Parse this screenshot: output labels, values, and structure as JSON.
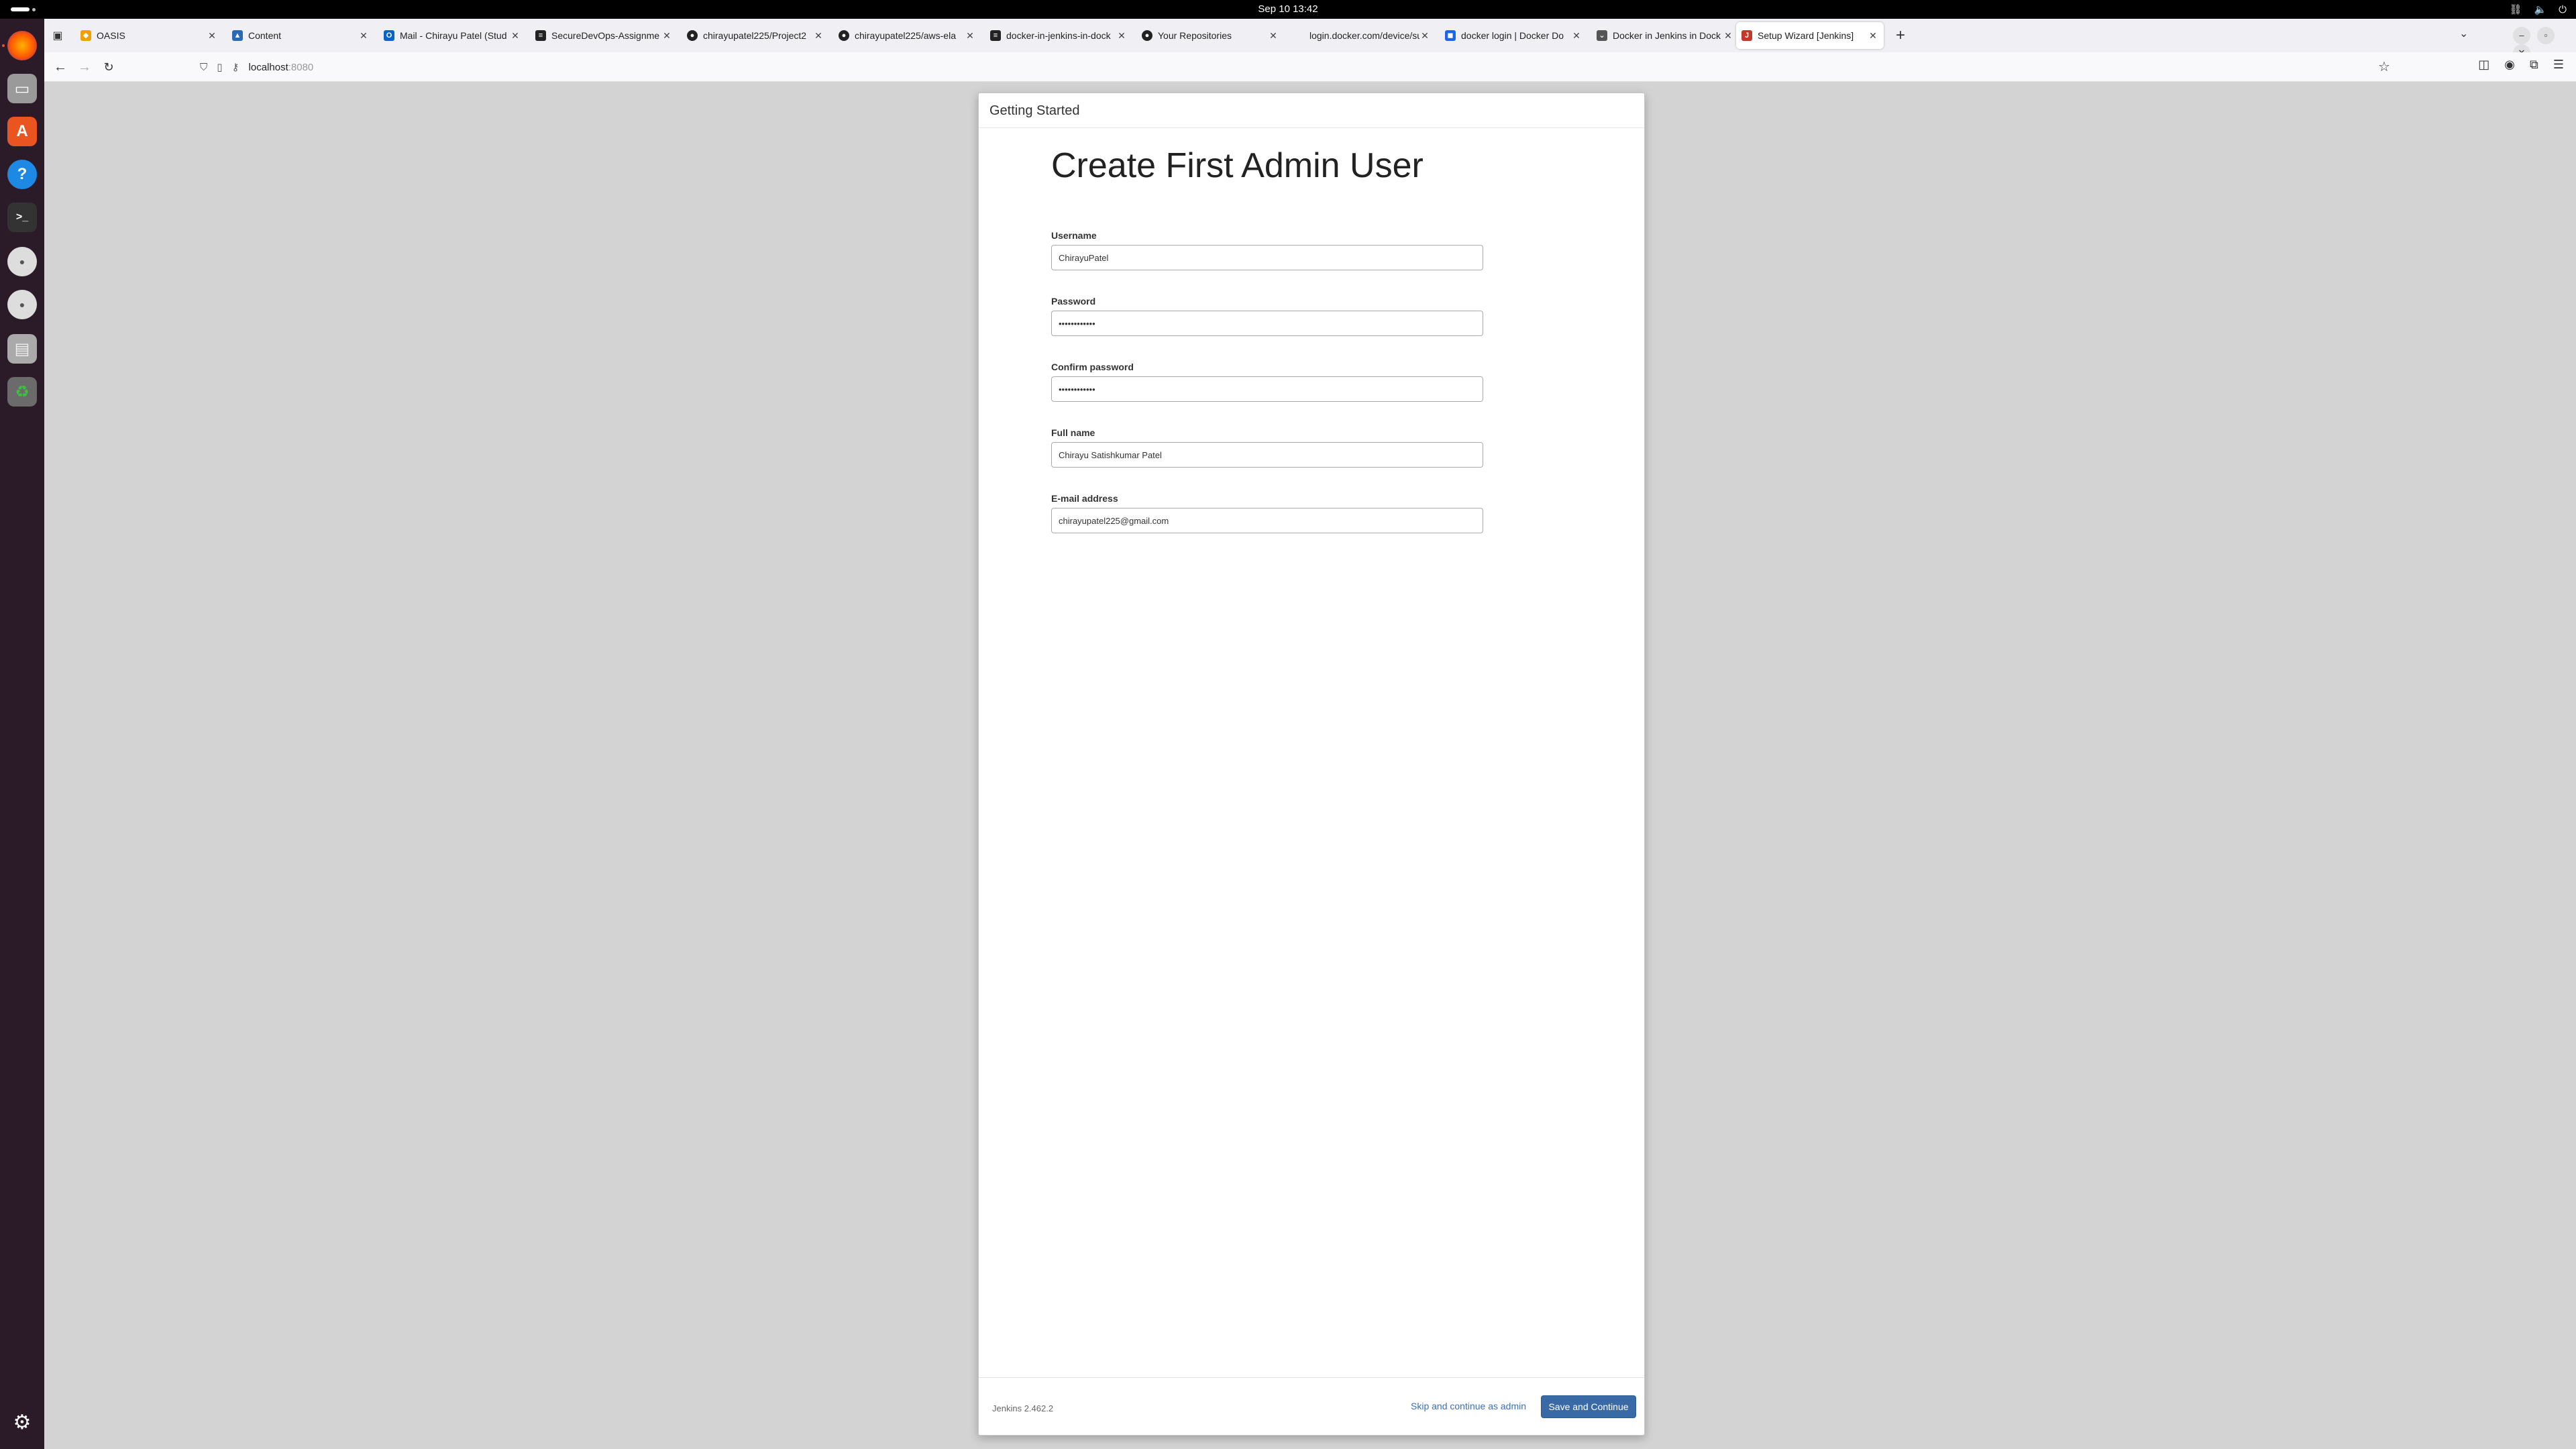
{
  "system": {
    "clock": "Sep 10  13:42"
  },
  "browser": {
    "tabs": [
      {
        "title": "OASIS",
        "icon": "oasis-icon",
        "color": "#f0a000"
      },
      {
        "title": "Content",
        "icon": "content-icon",
        "color": "#2a6ab5"
      },
      {
        "title": "Mail - Chirayu Patel (Stud",
        "icon": "outlook-icon",
        "color": "#0a64c8"
      },
      {
        "title": "SecureDevOps-Assignme",
        "icon": "docs-icon",
        "color": "#222222"
      },
      {
        "title": "chirayupatel225/Project2",
        "icon": "github-icon",
        "color": "#222222"
      },
      {
        "title": "chirayupatel225/aws-ela",
        "icon": "github-icon",
        "color": "#222222"
      },
      {
        "title": "docker-in-jenkins-in-dock",
        "icon": "docs-icon",
        "color": "#222222"
      },
      {
        "title": "Your Repositories",
        "icon": "github-icon",
        "color": "#222222"
      },
      {
        "title": "login.docker.com/device/su",
        "icon": "",
        "color": ""
      },
      {
        "title": "docker login | Docker Do",
        "icon": "docker-icon",
        "color": "#1d63ed"
      },
      {
        "title": "Docker in Jenkins in Dock",
        "icon": "docker-icon",
        "color": "#555555"
      },
      {
        "title": "Setup Wizard [Jenkins]",
        "icon": "jenkins-icon",
        "color": "#c0392b"
      }
    ],
    "url": {
      "host": "localhost",
      "port": ":8080"
    }
  },
  "dialog": {
    "header": "Getting Started",
    "title": "Create First Admin User",
    "fields": {
      "username": {
        "label": "Username",
        "value": "ChirayuPatel"
      },
      "password": {
        "label": "Password",
        "value": "••••••••••••"
      },
      "confirm_password": {
        "label": "Confirm password",
        "value": "••••••••••••"
      },
      "full_name": {
        "label": "Full name",
        "value": "Chirayu Satishkumar Patel"
      },
      "email": {
        "label": "E-mail address",
        "value": "chirayupatel225@gmail.com"
      }
    },
    "footer": {
      "version": "Jenkins 2.462.2",
      "skip_label": "Skip and continue as admin",
      "save_label": "Save and Continue"
    }
  },
  "colors": {
    "primary_button": "#3a6aa6",
    "link": "#3b6fb6",
    "dock": "#2b1b28"
  }
}
